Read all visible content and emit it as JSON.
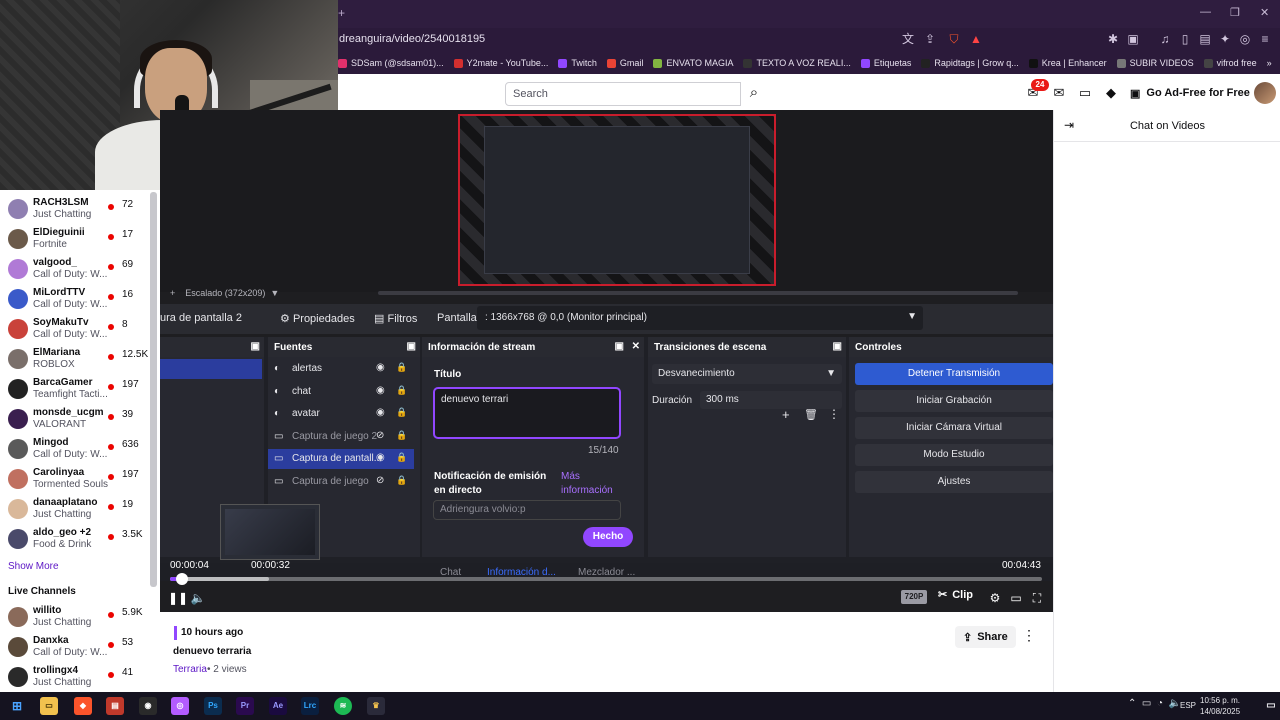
{
  "browser": {
    "url": "dreanguira/video/2540018195",
    "bookmarks": [
      {
        "label": "SDSam (@sdsam01)...",
        "color": "#e1306c"
      },
      {
        "label": "Y2mate - YouTube...",
        "color": "#d32f2f"
      },
      {
        "label": "Twitch",
        "color": "#9147ff"
      },
      {
        "label": "Gmail",
        "color": "#ea4335"
      },
      {
        "label": "ENVATO MAGIA",
        "color": "#82b541"
      },
      {
        "label": "TEXTO A VOZ REALI...",
        "color": "#333333"
      },
      {
        "label": "Etiquetas",
        "color": "#9147ff"
      },
      {
        "label": "Rapidtags | Grow q...",
        "color": "#222222"
      },
      {
        "label": "Krea | Enhancer",
        "color": "#111111"
      },
      {
        "label": "SUBIR VIDEOS",
        "color": "#777777"
      },
      {
        "label": "vifrod free",
        "color": "#444444"
      }
    ]
  },
  "header": {
    "search_placeholder": "Search",
    "notification_count": "24",
    "adfree_label": "Go Ad-Free for Free"
  },
  "sidebar": {
    "channels": [
      {
        "name": "RACH3LSM",
        "game": "Just Chatting",
        "viewers": "72",
        "color": "#8f7fb1"
      },
      {
        "name": "ElDieguinii",
        "game": "Fortnite",
        "viewers": "17",
        "color": "#6b5a4a"
      },
      {
        "name": "valgood_",
        "game": "Call of Duty: W...",
        "viewers": "69",
        "color": "#b07ad6"
      },
      {
        "name": "MiLordTTV",
        "game": "Call of Duty: W...",
        "viewers": "16",
        "color": "#3a5ac9"
      },
      {
        "name": "SoyMakuTv",
        "game": "Call of Duty: W...",
        "viewers": "8",
        "color": "#c9423a"
      },
      {
        "name": "ElMariana",
        "game": "ROBLOX",
        "viewers": "12.5K",
        "color": "#7a6f6a"
      },
      {
        "name": "BarcaGamer",
        "game": "Teamfight Tacti...",
        "viewers": "197",
        "color": "#222222"
      },
      {
        "name": "monsde_ucgm",
        "game": "VALORANT",
        "viewers": "39",
        "color": "#3a1f4f"
      },
      {
        "name": "Mingod",
        "game": "Call of Duty: W...",
        "viewers": "636",
        "color": "#5a5a5a"
      },
      {
        "name": "Carolinyaa",
        "game": "Tormented Souls",
        "viewers": "197",
        "color": "#c07060"
      },
      {
        "name": "danaaplatano",
        "game": "Just Chatting",
        "viewers": "19",
        "color": "#d9b89a"
      },
      {
        "name": "aldo_geo +2",
        "game": "Food & Drink",
        "viewers": "3.5K",
        "color": "#4a4a6a"
      }
    ],
    "show_more": "Show More",
    "live_channels_title": "Live Channels",
    "live_channels": [
      {
        "name": "willito",
        "game": "Just Chatting",
        "viewers": "5.9K",
        "color": "#8a6a5a"
      },
      {
        "name": "Danxka",
        "game": "Call of Duty: W...",
        "viewers": "53",
        "color": "#5a4a3a"
      },
      {
        "name": "trollingx4",
        "game": "Just Chatting",
        "viewers": "41",
        "color": "#2a2a2a"
      }
    ]
  },
  "obs": {
    "scaled_label": "Escalado (372x209)",
    "scene_tab": "ura de pantalla 2",
    "props_label": "Propiedades",
    "filters_label": "Filtros",
    "screen_label": "Pantalla",
    "screen_value": ": 1366x768 @ 0,0 (Monitor principal)",
    "sources_title": "Fuentes",
    "sources": [
      {
        "name": "alertas",
        "style": ""
      },
      {
        "name": "chat",
        "style": ""
      },
      {
        "name": "avatar",
        "style": ""
      },
      {
        "name": "Captura de juego 2",
        "style": "dim"
      },
      {
        "name": "Captura de pantall...",
        "style": "sel"
      },
      {
        "name": "Captura de juego",
        "style": "dim"
      }
    ],
    "stream_info_title": "Información de stream",
    "title_label": "Título",
    "title_value": "denuevo terrari",
    "char_count": "15/140",
    "notif_label": "Notificación de emisión en directo",
    "more_info": "Más información",
    "notif_value": "Adriengura volvio:p",
    "done_label": "Hecho",
    "transitions_title": "Transiciones de escena",
    "transition_value": "Desvanecimiento",
    "duration_label": "Duración",
    "duration_value": "300 ms",
    "controls_title": "Controles",
    "controls": [
      "Detener Transmisión",
      "Iniciar Grabación",
      "Iniciar Cámara Virtual",
      "Modo Estudio",
      "Ajustes"
    ],
    "bottom_tabs": [
      "Chat",
      "Información d...",
      "Mezclador ..."
    ]
  },
  "player": {
    "time_current": "00:00:04",
    "time_hover": "00:00:32",
    "time_total": "00:04:43",
    "progress_fraction": 0.014,
    "hover_fraction": 0.113,
    "quality": "720P",
    "clip_label": "Clip"
  },
  "chat": {
    "title": "Chat on Videos"
  },
  "meta": {
    "time_ago": "10 hours ago",
    "title": "denuevo terraria",
    "game": "Terraria",
    "views": "• 2 views",
    "share_label": "Share"
  },
  "taskbar": {
    "lang": "ESP",
    "time": "10:56 p. m.",
    "date": "14/08/2025"
  }
}
